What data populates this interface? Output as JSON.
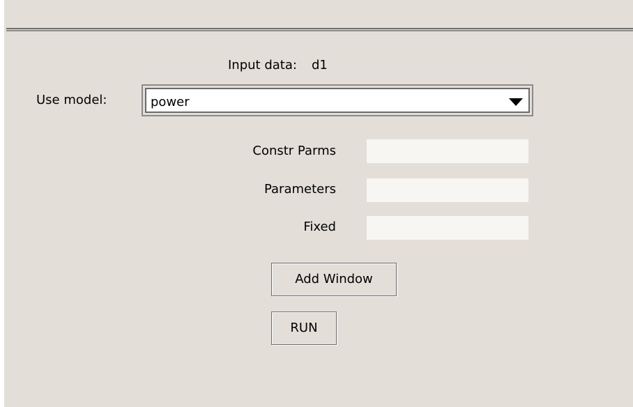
{
  "input": {
    "label": "Input data:",
    "value": "d1"
  },
  "model": {
    "label": "Use model:",
    "selected": "power",
    "arrow_icon": "triangle-down-icon"
  },
  "params": {
    "constr_label": "Constr Parms",
    "constr_value": "",
    "parameters_label": "Parameters",
    "parameters_value": "",
    "fixed_label": "Fixed",
    "fixed_value": ""
  },
  "buttons": {
    "add_window": "Add Window",
    "run": "RUN"
  },
  "colors": {
    "background": "#e3dfd8",
    "field_background": "#f7f6f3",
    "separator": "#6f6f6f"
  }
}
